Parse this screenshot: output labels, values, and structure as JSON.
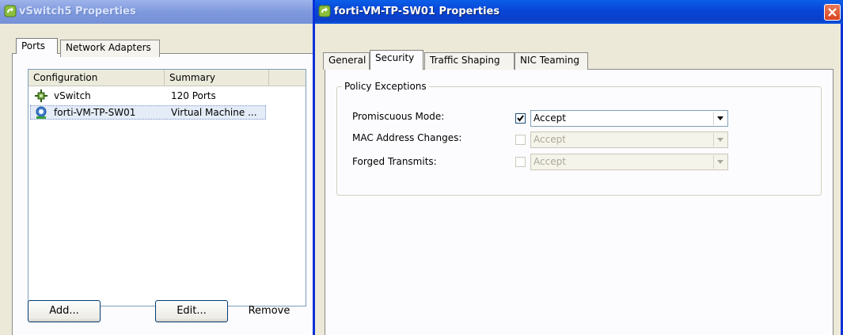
{
  "left_window": {
    "title": "vSwitch5 Properties",
    "tabs": [
      {
        "label": "Ports",
        "active": true
      },
      {
        "label": "Network Adapters",
        "active": false
      }
    ],
    "list": {
      "columns": [
        "Configuration",
        "Summary"
      ],
      "rows": [
        {
          "icon": "vswitch-icon",
          "configuration": "vSwitch",
          "summary": "120 Ports",
          "selected": false
        },
        {
          "icon": "port-group-icon",
          "configuration": "forti-VM-TP-SW01",
          "summary": "Virtual Machine ...",
          "selected": true
        }
      ]
    },
    "buttons": {
      "add": "Add...",
      "edit": "Edit...",
      "remove": "Remove"
    }
  },
  "right_window": {
    "title": "forti-VM-TP-SW01 Properties",
    "tabs": [
      {
        "label": "General",
        "active": false
      },
      {
        "label": "Security",
        "active": true
      },
      {
        "label": "Traffic Shaping",
        "active": false
      },
      {
        "label": "NIC Teaming",
        "active": false
      }
    ],
    "group_title": "Policy Exceptions",
    "policies": [
      {
        "label": "Promiscuous Mode:",
        "override_checked": true,
        "value": "Accept",
        "enabled": true
      },
      {
        "label": "MAC Address Changes:",
        "override_checked": false,
        "value": "Accept",
        "enabled": false
      },
      {
        "label": "Forged Transmits:",
        "override_checked": false,
        "value": "Accept",
        "enabled": false
      }
    ]
  },
  "colors": {
    "active_titlebar": "#0a46d6",
    "inactive_titlebar": "#7f99dd",
    "close_button": "#d8431c",
    "window_face": "#ece9d8"
  }
}
